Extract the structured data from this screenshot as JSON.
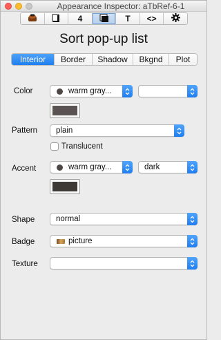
{
  "window": {
    "title": "Appearance Inspector: aTbRef-6-1"
  },
  "toolbar": {
    "buttons": [
      {
        "name": "general",
        "glyph": ""
      },
      {
        "name": "text-color",
        "glyph": ""
      },
      {
        "name": "digit",
        "glyph": "4"
      },
      {
        "name": "appearance",
        "glyph": ""
      },
      {
        "name": "text",
        "glyph": "T"
      },
      {
        "name": "html",
        "glyph": "<>"
      },
      {
        "name": "settings",
        "glyph": ""
      }
    ],
    "active": "appearance"
  },
  "heading": "Sort pop-up list",
  "tabs": [
    "Interior",
    "Border",
    "Shadow",
    "Bkgnd",
    "Plot"
  ],
  "active_tab": "Interior",
  "fields": {
    "color": {
      "label": "Color",
      "value": "warm gray...",
      "secondary_value": "",
      "swatch_color": "#5a5552"
    },
    "pattern": {
      "label": "Pattern",
      "value": "plain"
    },
    "translucent": {
      "label": "Translucent",
      "checked": false
    },
    "accent": {
      "label": "Accent",
      "value": "warm gray...",
      "secondary_value": "dark",
      "swatch_color": "#3d3937"
    },
    "shape": {
      "label": "Shape",
      "value": "normal"
    },
    "badge": {
      "label": "Badge",
      "value": "picture"
    },
    "texture": {
      "label": "Texture",
      "value": ""
    }
  },
  "colors": {
    "accent_blue": "#1f7ef0",
    "window_bg": "#ececec"
  }
}
